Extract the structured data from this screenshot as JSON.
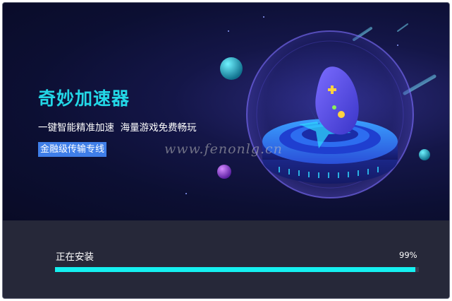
{
  "app": {
    "title": "奇妙加速器",
    "tagline": "一键智能精准加速  海量游戏免费畅玩",
    "badge": "金融级传输专线"
  },
  "watermark": "www.fenonlg.cn",
  "install": {
    "status_label": "正在安装",
    "percent_text": "99%",
    "progress": 0.99
  },
  "colors": {
    "accent": "#23d7e6",
    "progress_fill": "#15f0f0",
    "badge_bg": "#3f7ee8",
    "hero_bg": "#0c0f33",
    "panel_bg": "#262839"
  }
}
